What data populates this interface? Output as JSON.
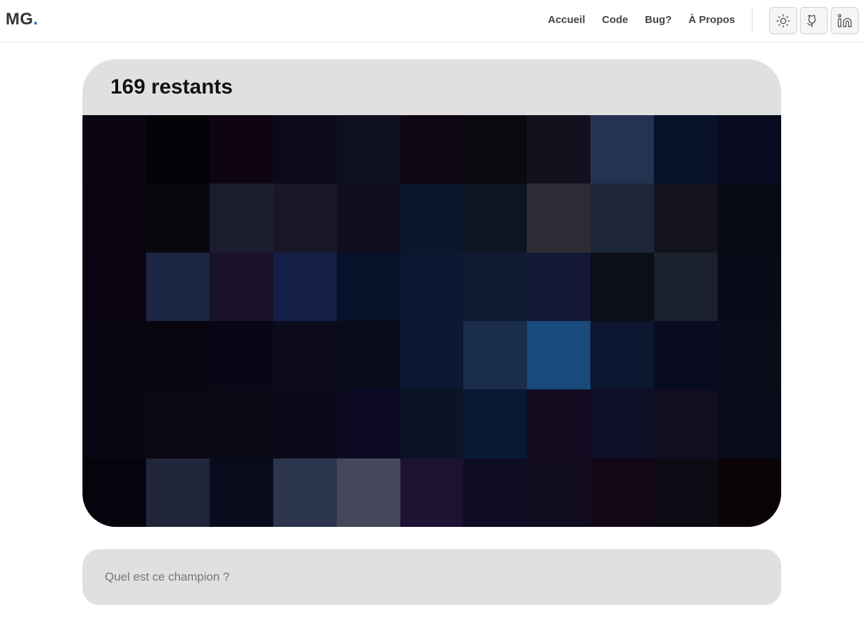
{
  "header": {
    "logo": "MG",
    "logo_dot": ".",
    "nav": [
      "Accueil",
      "Code",
      "Bug?",
      "À Propos"
    ],
    "icons": [
      "sun-icon",
      "github-icon",
      "linkedin-icon"
    ]
  },
  "game": {
    "remaining_label": "169 restants",
    "pixel_grid": {
      "cols": 11,
      "rows": 6,
      "colors": [
        [
          "#0b0611",
          "#050308",
          "#0e0412",
          "#0c0a18",
          "#0e1021",
          "#0e0612",
          "#0b0810",
          "#13111e",
          "#233351",
          "#08112a",
          "#080a1f"
        ],
        [
          "#09040f",
          "#0a080f",
          "#1c1d2f",
          "#181828",
          "#0f0e21",
          "#0b152e",
          "#0c1524",
          "#2d2b34",
          "#1d2638",
          "#13121f",
          "#060a12"
        ],
        [
          "#0a0412",
          "#1b2440",
          "#181129",
          "#142047",
          "#08112a",
          "#0a1832",
          "#101a33",
          "#141836",
          "#0c0e18",
          "#1b212c",
          "#070a17"
        ],
        [
          "#0a0512",
          "#090612",
          "#0a0615",
          "#0c0b1e",
          "#0a0c1c",
          "#0c1731",
          "#1a2d4d",
          "#184a7c",
          "#0c1631",
          "#080c1e",
          "#0b0d1a"
        ],
        [
          "#0a0512",
          "#0b0814",
          "#0a0a16",
          "#0a0918",
          "#0c0b23",
          "#0c1326",
          "#071933",
          "#130a1f",
          "#0c0f25",
          "#120d21",
          "#090b1a"
        ],
        [
          "#07030d",
          "#20253a",
          "#080b1c",
          "#2b354e",
          "#45475a",
          "#1c1232",
          "#0d0c22",
          "#100b1e",
          "#130615",
          "#0d0b13",
          "#0a0409"
        ]
      ]
    }
  },
  "guess_input": {
    "placeholder": "Quel est ce champion ?",
    "value": ""
  },
  "colors": {
    "accent": "#1e66d0",
    "card_background": "#e0e0e0"
  }
}
